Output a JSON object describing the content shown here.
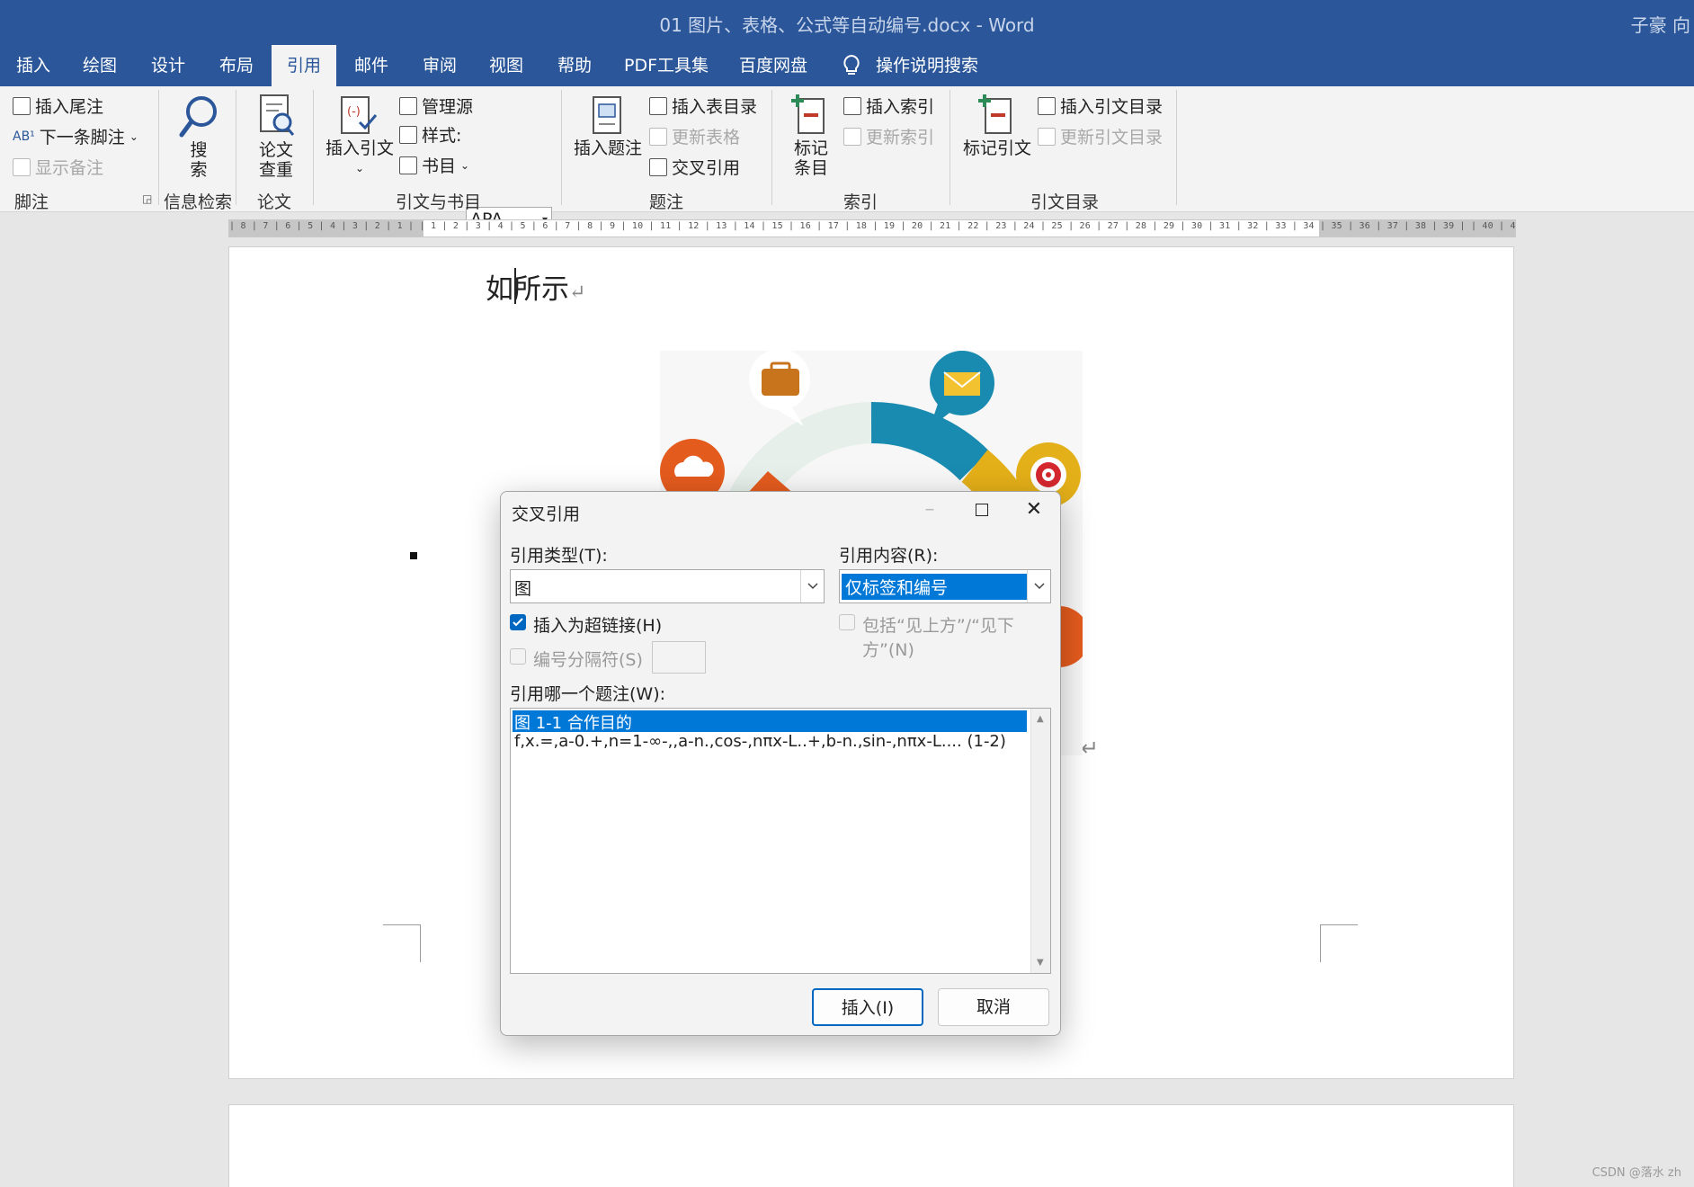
{
  "window": {
    "title": "01 图片、表格、公式等自动编号.docx  -  Word",
    "user": "子豪 向"
  },
  "tabs": [
    {
      "label": "插入"
    },
    {
      "label": "绘图"
    },
    {
      "label": "设计"
    },
    {
      "label": "布局"
    },
    {
      "label": "引用",
      "active": true
    },
    {
      "label": "邮件"
    },
    {
      "label": "审阅"
    },
    {
      "label": "视图"
    },
    {
      "label": "帮助"
    },
    {
      "label": "PDF工具集"
    },
    {
      "label": "百度网盘"
    },
    {
      "label": "操作说明搜索"
    }
  ],
  "ribbon": {
    "footnote": {
      "insert_endnote": "插入尾注",
      "next_footnote": "下一条脚注",
      "show_notes": "显示备注",
      "group": "脚注"
    },
    "research": {
      "search_line1": "搜",
      "search_line2": "索",
      "group": "信息检索"
    },
    "thesis": {
      "check_line1": "论文",
      "check_line2": "查重",
      "group": "论文"
    },
    "citations": {
      "insert_citation": "插入引文",
      "manage_sources": "管理源",
      "style_label": "样式:",
      "style_value": "APA",
      "bibliography": "书目",
      "group": "引文与书目"
    },
    "captions": {
      "insert_caption": "插入题注",
      "insert_table_of_figures": "插入表目录",
      "update_table": "更新表格",
      "cross_reference": "交叉引用",
      "group": "题注"
    },
    "index": {
      "mark_entry_line1": "标记",
      "mark_entry_line2": "条目",
      "insert_index": "插入索引",
      "update_index": "更新索引",
      "group": "索引"
    },
    "toa": {
      "mark_citation": "标记引文",
      "insert_toa": "插入引文目录",
      "update_toa": "更新引文目录",
      "group": "引文目录"
    }
  },
  "ruler": {
    "text": "| 8 | 7 | 6 | 5 | 4 | 3 | 2 | 1 |    | 1 | 2 | 3 | 4 | 5 | 6 | 7 | 8 | 9 | 10 | 11 | 12 | 13 | 14 | 15 | 16 | 17 | 18 | 19 | 20 | 21 | 22 | 23 | 24 | 25 | 26 | 27 | 28 | 29 | 30 | 31 | 32 | 33 | 34 | 35 | 36 | 37 | 38 | 39 |    | 40 | 41 | 42 | 43 | 44 | 45 | 46 | 47 | 48"
  },
  "document": {
    "line1_a": "如",
    "line1_b": "所示",
    "para_mark": "↵"
  },
  "dialog": {
    "title": "交叉引用",
    "reference_type_label": "引用类型(T):",
    "reference_type_value": "图",
    "insert_as_hyperlink": {
      "label": "插入为超链接(H)",
      "checked": true
    },
    "separate_numbers": {
      "label": "编号分隔符(S)",
      "checked": false,
      "enabled": false
    },
    "reference_content_label": "引用内容(R):",
    "reference_content_value": "仅标签和编号",
    "include_above_below": {
      "label": "包括“见上方”/“见下方”(N)",
      "checked": false,
      "enabled": false
    },
    "which_caption_label": "引用哪一个题注(W):",
    "captions": [
      {
        "text": "图 1-1 合作目的",
        "selected": true
      },
      {
        "text": "f,x.=,a-0.+,n=1-∞-,,a-n.,cos-,nπx-L..+,b-n.,sin-,nπx-L....  (1-2)",
        "selected": false
      }
    ],
    "insert_button": "插入(I)",
    "cancel_button": "取消"
  },
  "watermark": "CSDN @落水 zh",
  "colors": {
    "word_blue": "#2b579a",
    "selection_blue": "#0078d7",
    "checkbox_blue": "#0067c0"
  }
}
